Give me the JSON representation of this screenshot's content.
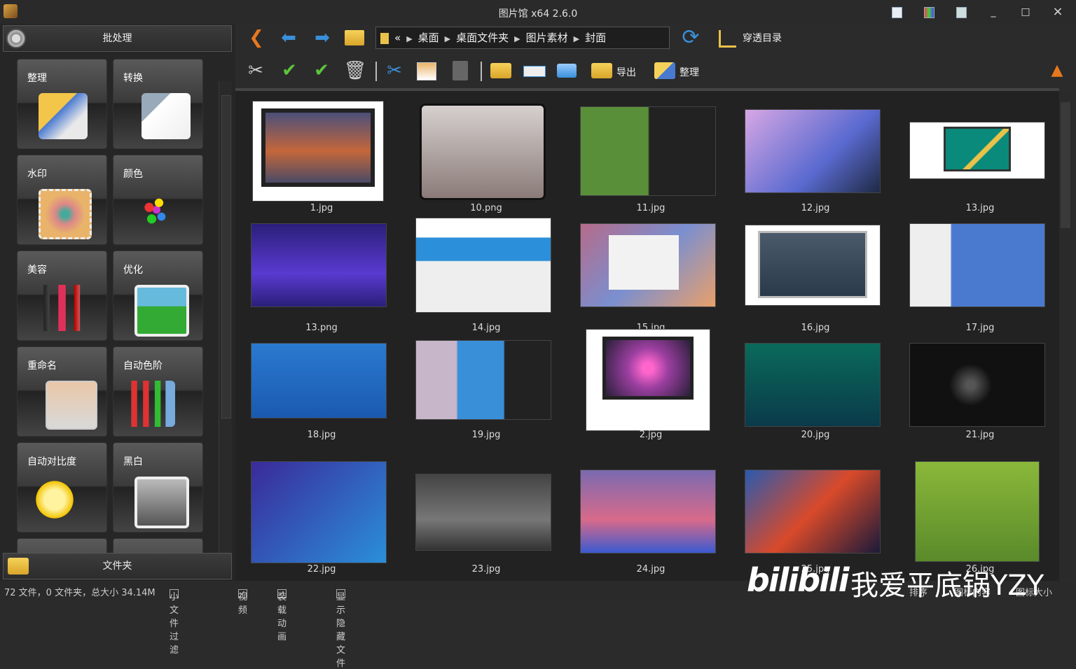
{
  "window": {
    "title": "图片馆 x64 2.6.0",
    "minimize": "_",
    "maximize": "□",
    "close": "×"
  },
  "left_panel": {
    "header": "批处理",
    "footer": "文件夹",
    "tiles": [
      "整理",
      "转换",
      "水印",
      "颜色",
      "美容",
      "优化",
      "重命名",
      "自动色阶",
      "自动对比度",
      "黑白"
    ]
  },
  "nav": {
    "back_icon": "❮",
    "up_icon": "⬅",
    "forward_icon": "➡",
    "breadcrumb_prefix": "«",
    "breadcrumb": [
      "桌面",
      "桌面文件夹",
      "图片素材",
      "封面"
    ],
    "refresh_icon": "⟳",
    "penetrate_label": "穿透目录"
  },
  "toolbar": {
    "export_label": "导出",
    "organize_label": "整理"
  },
  "files": [
    "1.jpg",
    "10.png",
    "11.jpg",
    "12.jpg",
    "13.jpg",
    "13.png",
    "14.jpg",
    "15.jpg",
    "16.jpg",
    "17.jpg",
    "18.jpg",
    "19.jpg",
    "2.jpg",
    "20.jpg",
    "21.jpg",
    "22.jpg",
    "23.jpg",
    "24.jpg",
    "25.jpg",
    "26.jpg"
  ],
  "status": {
    "summary": "72 文件，0 文件夹，总大小 34.14M",
    "small_file_filter": "小文件过滤",
    "video": "视频",
    "load_animation": "装载动画",
    "show_hidden": "显示隐藏文件",
    "sort": "排序",
    "icon_content": "图标内容",
    "icon_size": "图标大小"
  },
  "watermark": {
    "logo": "bilibili",
    "text": "我爱平底锅YZY"
  },
  "colors": {
    "accent_orange": "#e8781e",
    "blue_arrow": "#3a8fd9",
    "green_check": "#5cc43c",
    "folder": "#e8c24a"
  }
}
